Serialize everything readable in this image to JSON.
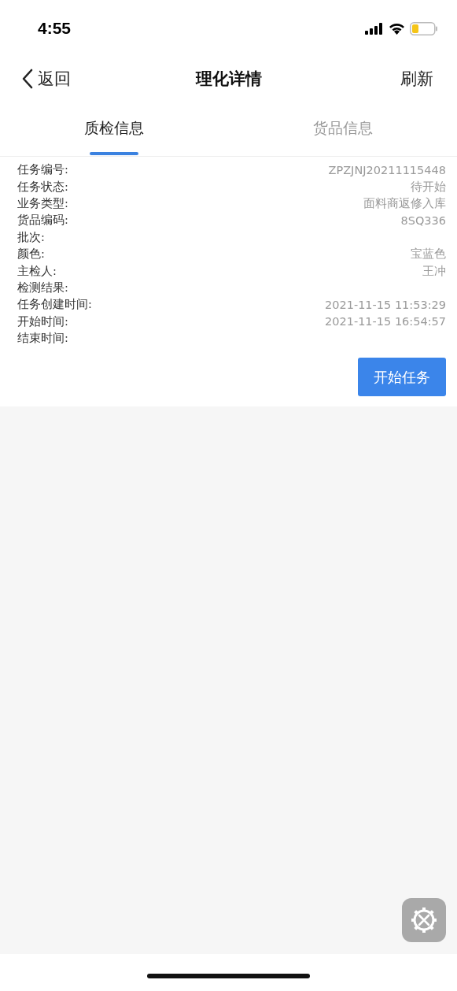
{
  "status_bar": {
    "time": "4:55"
  },
  "nav": {
    "back": "返回",
    "title": "理化详情",
    "action": "刷新"
  },
  "tabs": [
    {
      "label": "质检信息",
      "selected": true
    },
    {
      "label": "货品信息",
      "selected": false
    }
  ],
  "fields": [
    {
      "label": "任务编号:",
      "value": "ZPZJNJ20211115448"
    },
    {
      "label": "任务状态:",
      "value": "待开始"
    },
    {
      "label": "业务类型:",
      "value": "面料商返修入库"
    },
    {
      "label": "货品编码:",
      "value": "8SQ336"
    },
    {
      "label": "批次:"
    },
    {
      "label": "颜色:",
      "value": "宝蓝色"
    },
    {
      "label": "主检人:",
      "value": "王冲"
    },
    {
      "label": "检测结果:"
    },
    {
      "label": "任务创建时间:",
      "value": "2021-11-15 11:53:29"
    },
    {
      "label": "开始时间:",
      "value": "2021-11-15 16:54:57"
    },
    {
      "label": "结束时间:"
    }
  ],
  "primary_button": "开始任务"
}
